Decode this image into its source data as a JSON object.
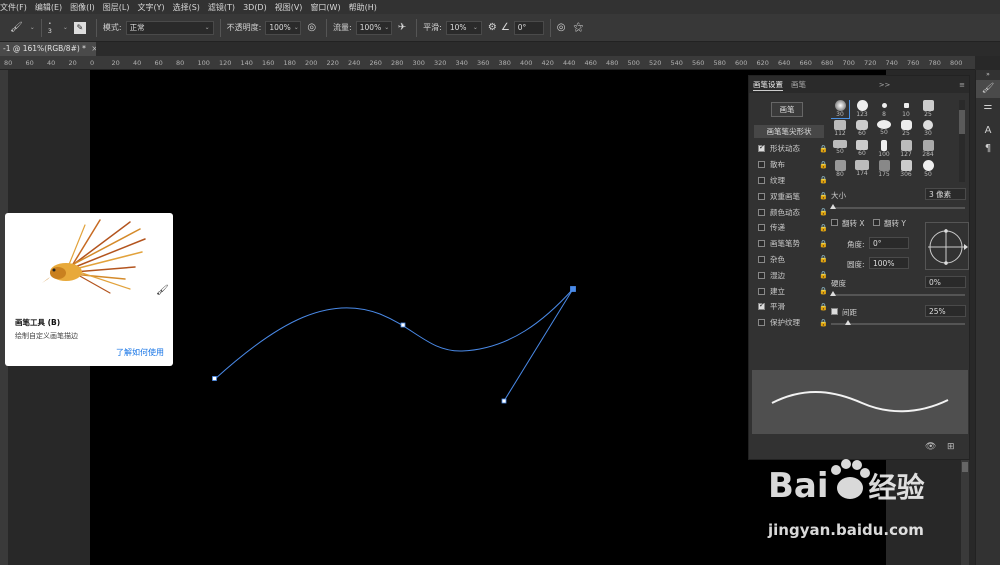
{
  "menu": [
    "文件(F)",
    "编辑(E)",
    "图像(I)",
    "图层(L)",
    "文字(Y)",
    "选择(S)",
    "滤镜(T)",
    "3D(D)",
    "视图(V)",
    "窗口(W)",
    "帮助(H)"
  ],
  "options": {
    "brush_size": "3",
    "mode_label": "模式:",
    "mode_value": "正常",
    "opacity_label": "不透明度:",
    "opacity_value": "100%",
    "flow_label": "流量:",
    "flow_value": "100%",
    "smooth_label": "平滑:",
    "smooth_value": "10%",
    "angle_value": "0°"
  },
  "document_tab": "-1 @ 161%(RGB/8#) *",
  "ruler_ticks": [
    "80",
    "60",
    "40",
    "20",
    "0",
    "20",
    "40",
    "60",
    "80",
    "100",
    "120",
    "140",
    "160",
    "180",
    "200",
    "220",
    "240",
    "260",
    "280",
    "300",
    "320",
    "340",
    "360",
    "380",
    "400",
    "420",
    "440",
    "460",
    "480",
    "500",
    "520",
    "540",
    "560",
    "580",
    "600",
    "620",
    "640",
    "660",
    "680",
    "700",
    "720",
    "740",
    "760",
    "780",
    "800"
  ],
  "tooltip": {
    "title": "画笔工具 (B)",
    "description": "绘制自定义画笔描边",
    "link": "了解如何使用"
  },
  "brush_panel": {
    "tabs": [
      "画笔设置",
      "画笔"
    ],
    "collapse": ">>",
    "brush_button": "画笔",
    "tip_shape": "画笔笔尖形状",
    "options": [
      {
        "name": "形状动态",
        "checked": true
      },
      {
        "name": "散布",
        "checked": false
      },
      {
        "name": "纹理",
        "checked": false
      },
      {
        "name": "双重画笔",
        "checked": false
      },
      {
        "name": "颜色动态",
        "checked": false
      },
      {
        "name": "传递",
        "checked": false
      },
      {
        "name": "画笔笔势",
        "checked": false
      },
      {
        "name": "杂色",
        "checked": false
      },
      {
        "name": "湿边",
        "checked": false
      },
      {
        "name": "建立",
        "checked": false
      },
      {
        "name": "平滑",
        "checked": true
      },
      {
        "name": "保护纹理",
        "checked": false
      }
    ],
    "presets_row1": [
      "30",
      "123",
      "8",
      "10",
      "25"
    ],
    "presets_row2": [
      "112",
      "60",
      "50",
      "25",
      "30"
    ],
    "presets_row3": [
      "50",
      "60",
      "100",
      "127",
      "284"
    ],
    "presets_row4": [
      "80",
      "174",
      "175",
      "306",
      "50"
    ],
    "size_label": "大小",
    "size_value": "3 像素",
    "flip_x": "翻转 X",
    "flip_y": "翻转 Y",
    "angle_label": "角度:",
    "angle_value": "0°",
    "roundness_label": "圆度:",
    "roundness_value": "100%",
    "hardness_label": "硬度",
    "hardness_value": "0%",
    "spacing_label": "间距",
    "spacing_value": "25%"
  },
  "watermark": {
    "brand": "Bai",
    "brand_suffix": "经验",
    "url": "jingyan.baidu.com"
  },
  "colors": {
    "path_blue": "#4a8ae8",
    "link_blue": "#1473e6",
    "canvas": "#000000",
    "panel": "#323232"
  }
}
